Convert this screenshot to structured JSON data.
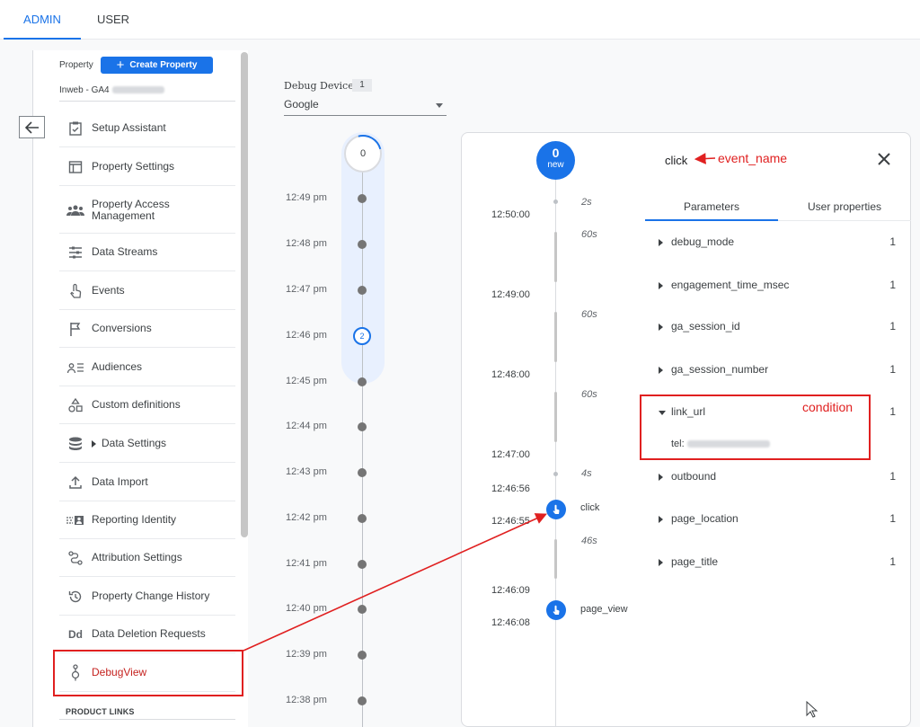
{
  "top_tabs": {
    "admin": "ADMIN",
    "user": "USER"
  },
  "property": {
    "label": "Property",
    "create_button": "Create Property",
    "name_prefix": "Inweb - GA4"
  },
  "nav": [
    {
      "label": "Setup Assistant",
      "icon": "clipboard-check-icon"
    },
    {
      "label": "Property Settings",
      "icon": "window-icon"
    },
    {
      "label": "Property Access Management",
      "icon": "people-icon"
    },
    {
      "label": "Data Streams",
      "icon": "streams-icon"
    },
    {
      "label": "Events",
      "icon": "touch-icon"
    },
    {
      "label": "Conversions",
      "icon": "flag-icon"
    },
    {
      "label": "Audiences",
      "icon": "audience-icon"
    },
    {
      "label": "Custom definitions",
      "icon": "shapes-icon"
    },
    {
      "label": "Data Settings",
      "icon": "database-icon"
    },
    {
      "label": "Data Import",
      "icon": "upload-icon"
    },
    {
      "label": "Reporting Identity",
      "icon": "identity-icon"
    },
    {
      "label": "Attribution Settings",
      "icon": "attribution-icon"
    },
    {
      "label": "Property Change History",
      "icon": "history-icon"
    },
    {
      "label": "Data Deletion Requests",
      "icon": "dd-icon"
    },
    {
      "label": "DebugView",
      "icon": "debug-icon",
      "active": true
    }
  ],
  "product_links": "PRODUCT LINKS",
  "debug_device": {
    "label": "Debug Device",
    "count": "1",
    "selected": "Google"
  },
  "minutes_stream": {
    "top_count": "0",
    "minutes": [
      "12:49 pm",
      "12:48 pm",
      "12:47 pm",
      "12:46 pm",
      "12:45 pm",
      "12:44 pm",
      "12:43 pm",
      "12:42 pm",
      "12:41 pm",
      "12:40 pm",
      "12:39 pm",
      "12:38 pm"
    ],
    "active_minute_count": "2"
  },
  "seconds_stream": {
    "new_count": "0",
    "new_label": "new",
    "times": [
      "12:50:00",
      "12:49:00",
      "12:48:00",
      "12:47:00",
      "12:46:56",
      "12:46:55",
      "12:46:09",
      "12:46:08"
    ],
    "gaps": [
      "2s",
      "60s",
      "60s",
      "60s",
      "4s",
      "46s"
    ],
    "events": [
      "click",
      "page_view"
    ]
  },
  "event_details": {
    "event_name": "click",
    "tabs": [
      "Parameters",
      "User properties"
    ],
    "parameters": [
      {
        "name": "debug_mode",
        "value": "1"
      },
      {
        "name": "engagement_time_msec",
        "value": "1"
      },
      {
        "name": "ga_session_id",
        "value": "1"
      },
      {
        "name": "ga_session_number",
        "value": "1"
      },
      {
        "name": "link_url",
        "value": "1",
        "expanded": true,
        "detail_prefix": "tel:"
      },
      {
        "name": "outbound",
        "value": "1"
      },
      {
        "name": "page_location",
        "value": "1"
      },
      {
        "name": "page_title",
        "value": "1"
      }
    ]
  },
  "annotations": {
    "event_name_note": "event_name",
    "condition_note": "condition",
    "color": "#e02020"
  },
  "colors": {
    "accent": "#1a73e8",
    "annotation": "#e02020"
  }
}
